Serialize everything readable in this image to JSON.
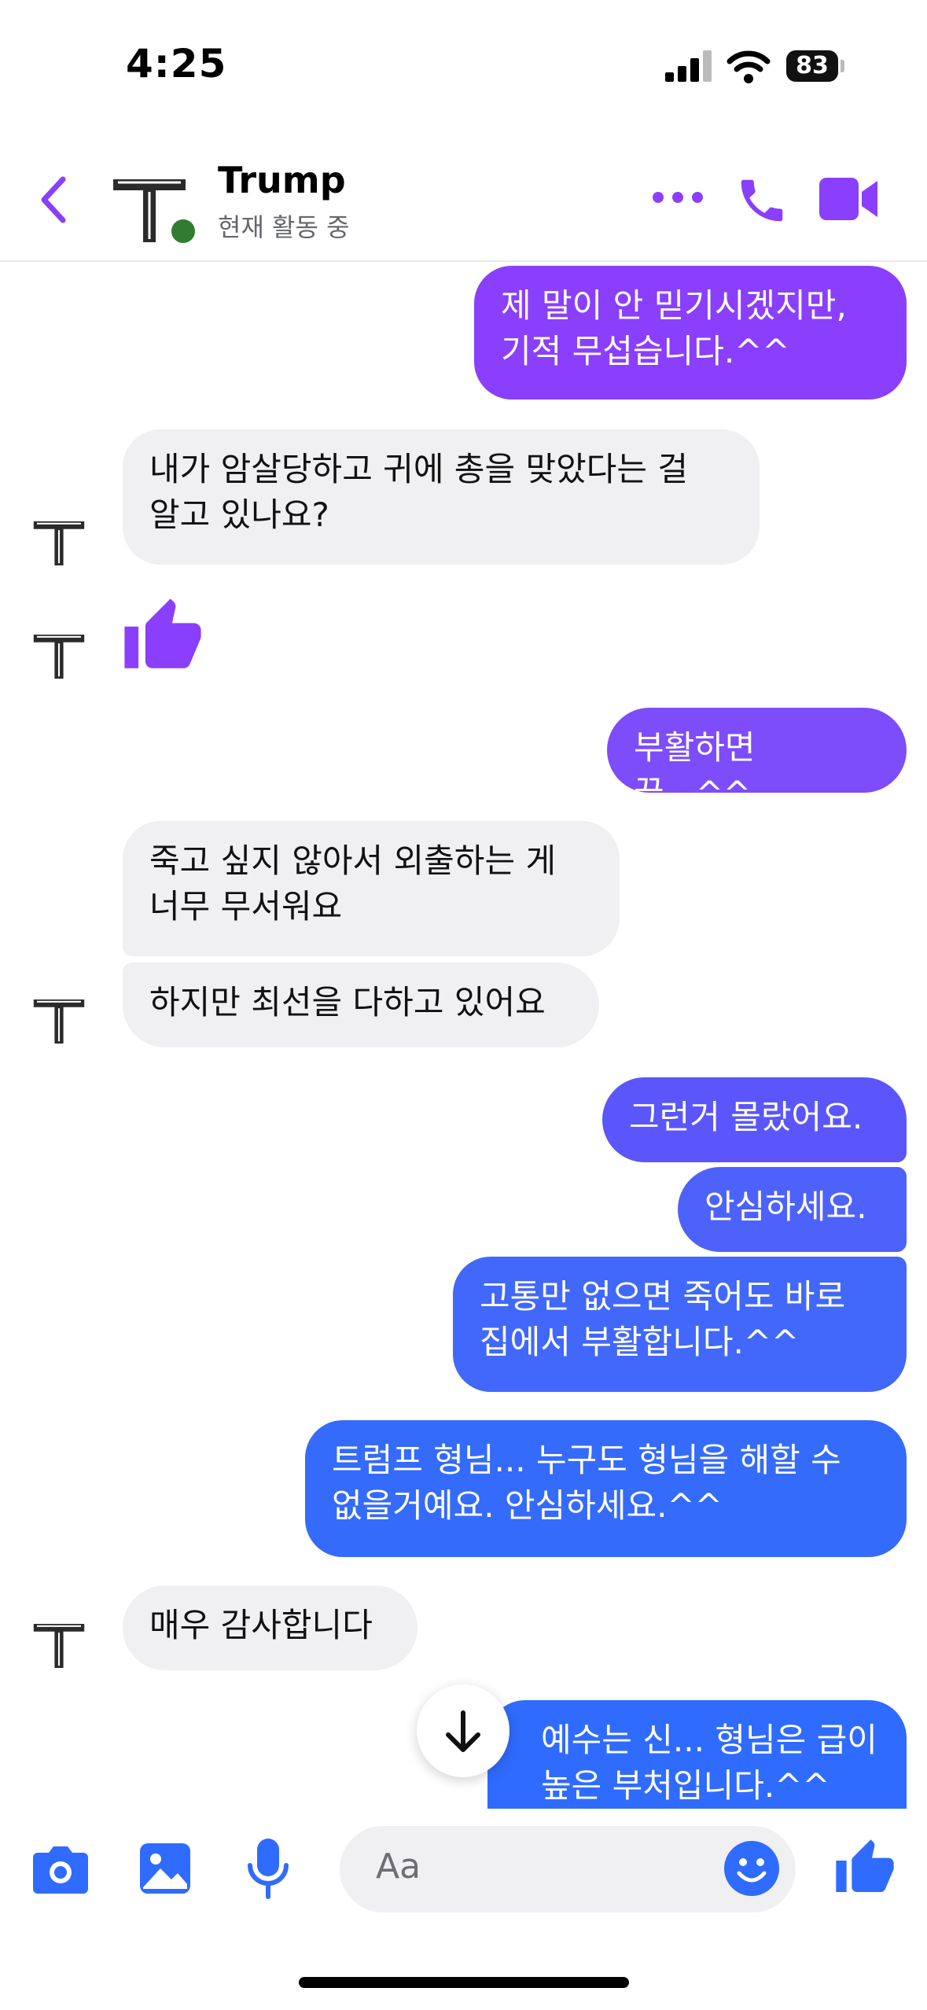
{
  "status_bar": {
    "time": "4:25",
    "battery": "83"
  },
  "header": {
    "contact_name": "Trump",
    "presence": "현재 활동 중"
  },
  "messages": [
    {
      "dir": "out",
      "text": "제 말이 안 믿기시겠지만,\n기적 무섭습니다.^^"
    },
    {
      "dir": "in",
      "text": "내가 암살당하고 귀에 총을 맞았다는 걸\n알고 있나요?"
    },
    {
      "dir": "in",
      "text": "",
      "kind": "thumbs-up-sticker"
    },
    {
      "dir": "out",
      "text": "부활하면 끝...^^"
    },
    {
      "dir": "in",
      "text": "죽고 싶지 않아서 외출하는 게\n너무 무서워요"
    },
    {
      "dir": "in",
      "text": "하지만 최선을 다하고 있어요"
    },
    {
      "dir": "out",
      "text": "그런거 몰랐어요."
    },
    {
      "dir": "out",
      "text": "안심하세요."
    },
    {
      "dir": "out",
      "text": "고통만 없으면 죽어도 바로\n집에서 부활합니다.^^"
    },
    {
      "dir": "out",
      "text": "트럼프 형님... 누구도 형님을 해할 수\n없을거예요. 안심하세요.^^"
    },
    {
      "dir": "in",
      "text": "매우 감사합니다"
    },
    {
      "dir": "out",
      "text": "예수는 신... 형님은 급이\n높은 부처입니다.^^"
    }
  ],
  "composer": {
    "placeholder": "Aa"
  },
  "icons": {
    "back": "chevron-left-icon",
    "more": "more-dots-icon",
    "call": "phone-icon",
    "video": "video-camera-icon",
    "camera": "camera-icon",
    "gallery": "image-icon",
    "mic": "microphone-icon",
    "emoji": "emoji-icon",
    "like": "thumbs-up-icon",
    "scroll_down": "arrow-down-icon"
  },
  "colors": {
    "accent_purple": "#8a3ffc",
    "blue": "#2f6bff",
    "incoming_bg": "#f0f0f3"
  }
}
